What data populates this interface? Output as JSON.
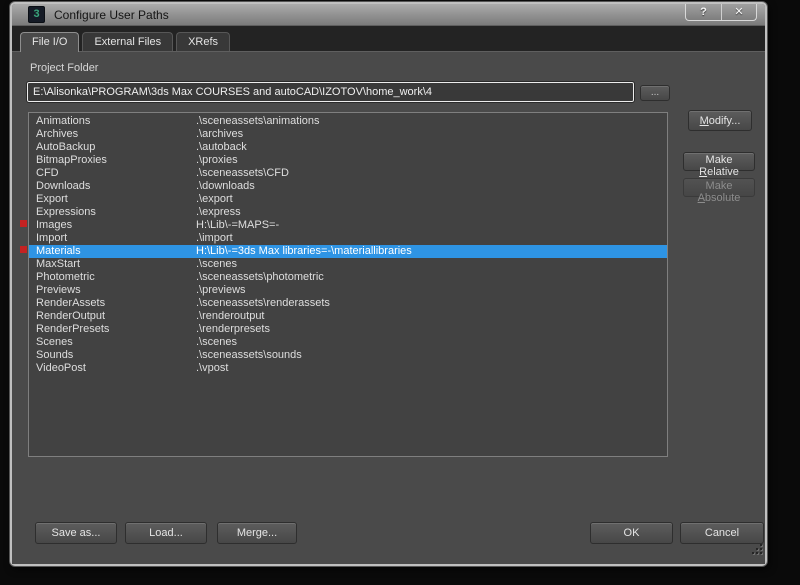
{
  "window": {
    "title": "Configure User Paths",
    "icon_glyph": "3",
    "help_glyph": "?",
    "close_glyph": "✕"
  },
  "tabs": [
    {
      "label": "File I/O",
      "active": true
    },
    {
      "label": "External Files",
      "active": false
    },
    {
      "label": "XRefs",
      "active": false
    }
  ],
  "project_folder": {
    "label": "Project Folder",
    "path": "E:\\Alisonka\\PROGRAM\\3ds Max COURSES and autoCAD\\IZOTOV\\home_work\\4",
    "browse_label": "..."
  },
  "paths_table": {
    "rows": [
      {
        "name": "Animations",
        "path": ".\\sceneassets\\animations",
        "flagged": false,
        "selected": false
      },
      {
        "name": "Archives",
        "path": ".\\archives",
        "flagged": false,
        "selected": false
      },
      {
        "name": "AutoBackup",
        "path": ".\\autoback",
        "flagged": false,
        "selected": false
      },
      {
        "name": "BitmapProxies",
        "path": ".\\proxies",
        "flagged": false,
        "selected": false
      },
      {
        "name": "CFD",
        "path": ".\\sceneassets\\CFD",
        "flagged": false,
        "selected": false
      },
      {
        "name": "Downloads",
        "path": ".\\downloads",
        "flagged": false,
        "selected": false
      },
      {
        "name": "Export",
        "path": ".\\export",
        "flagged": false,
        "selected": false
      },
      {
        "name": "Expressions",
        "path": ".\\express",
        "flagged": false,
        "selected": false
      },
      {
        "name": "Images",
        "path": "H:\\Lib\\-=MAPS=-",
        "flagged": true,
        "selected": false
      },
      {
        "name": "Import",
        "path": ".\\import",
        "flagged": false,
        "selected": false
      },
      {
        "name": "Materials",
        "path": "H:\\Lib\\-=3ds Max libraries=-\\materiallibraries",
        "flagged": true,
        "selected": true
      },
      {
        "name": "MaxStart",
        "path": ".\\scenes",
        "flagged": false,
        "selected": false
      },
      {
        "name": "Photometric",
        "path": ".\\sceneassets\\photometric",
        "flagged": false,
        "selected": false
      },
      {
        "name": "Previews",
        "path": ".\\previews",
        "flagged": false,
        "selected": false
      },
      {
        "name": "RenderAssets",
        "path": ".\\sceneassets\\renderassets",
        "flagged": false,
        "selected": false
      },
      {
        "name": "RenderOutput",
        "path": ".\\renderoutput",
        "flagged": false,
        "selected": false
      },
      {
        "name": "RenderPresets",
        "path": ".\\renderpresets",
        "flagged": false,
        "selected": false
      },
      {
        "name": "Scenes",
        "path": ".\\scenes",
        "flagged": false,
        "selected": false
      },
      {
        "name": "Sounds",
        "path": ".\\sceneassets\\sounds",
        "flagged": false,
        "selected": false
      },
      {
        "name": "VideoPost",
        "path": ".\\vpost",
        "flagged": false,
        "selected": false
      }
    ]
  },
  "actions": {
    "modify": {
      "label": "Modify...",
      "mnemonic": "M"
    },
    "make_relative": {
      "label": "Make Relative",
      "mnemonic": "R"
    },
    "make_absolute": {
      "label": "Make Absolute",
      "mnemonic": "A",
      "disabled": true
    }
  },
  "footer": {
    "save_as": "Save as...",
    "load": "Load...",
    "merge": "Merge...",
    "ok": "OK",
    "cancel": "Cancel"
  },
  "colors": {
    "selection": "#2e94e4",
    "flag": "#c42222"
  }
}
